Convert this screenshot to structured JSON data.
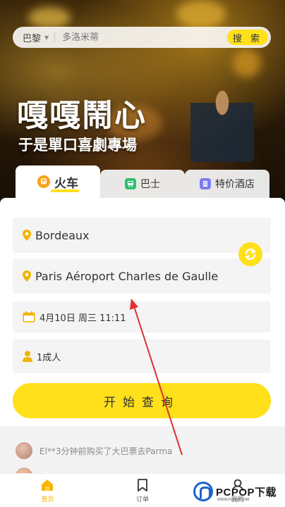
{
  "search": {
    "city": "巴黎",
    "placeholder": "多洛米蒂",
    "button": "搜 索"
  },
  "banner": {
    "title": "嘎嘎鬧心",
    "subtitle": "于是單口喜劇專場"
  },
  "tabs": [
    {
      "label": "火车",
      "icon": "train-icon",
      "active": true
    },
    {
      "label": "巴士",
      "icon": "bus-icon",
      "active": false
    },
    {
      "label": "特价酒店",
      "icon": "hotel-icon",
      "active": false
    }
  ],
  "form": {
    "from": "Bordeaux",
    "to": "Paris Aéroport Charles de Gaulle",
    "date": "4月10日 周三 11:11",
    "passengers": "1成人",
    "submit": "开始查询"
  },
  "ticker": {
    "message": "El**3分钟前购买了大巴票去Parma"
  },
  "bottom_nav": [
    {
      "label": "首页",
      "icon": "home-icon",
      "active": true
    },
    {
      "label": "订单",
      "icon": "bookmark-icon",
      "active": false
    },
    {
      "label": "我的",
      "icon": "profile-icon",
      "active": false
    }
  ],
  "watermark": {
    "text": "PCPOP下载",
    "small": "WWW.PCPOP.COM"
  },
  "colors": {
    "accent": "#ffe01b",
    "annotation": "#e03030",
    "watermark_blue": "#1e62c9"
  }
}
